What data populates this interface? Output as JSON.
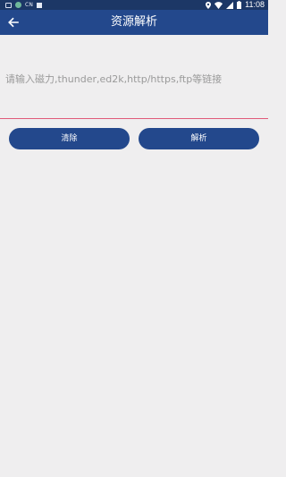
{
  "status_bar": {
    "notification_text": "CN",
    "time": "11:08"
  },
  "app_bar": {
    "title": "资源解析"
  },
  "input": {
    "placeholder": "请输入磁力,thunder,ed2k,http/https,ftp等链接",
    "value": ""
  },
  "buttons": {
    "clear_label": "清除",
    "parse_label": "解析"
  },
  "colors": {
    "status_bar_bg": "#1c3766",
    "app_bar_bg": "#23488c",
    "button_bg": "#23488c",
    "input_underline": "#e05a7a",
    "page_bg": "#efeeef"
  }
}
